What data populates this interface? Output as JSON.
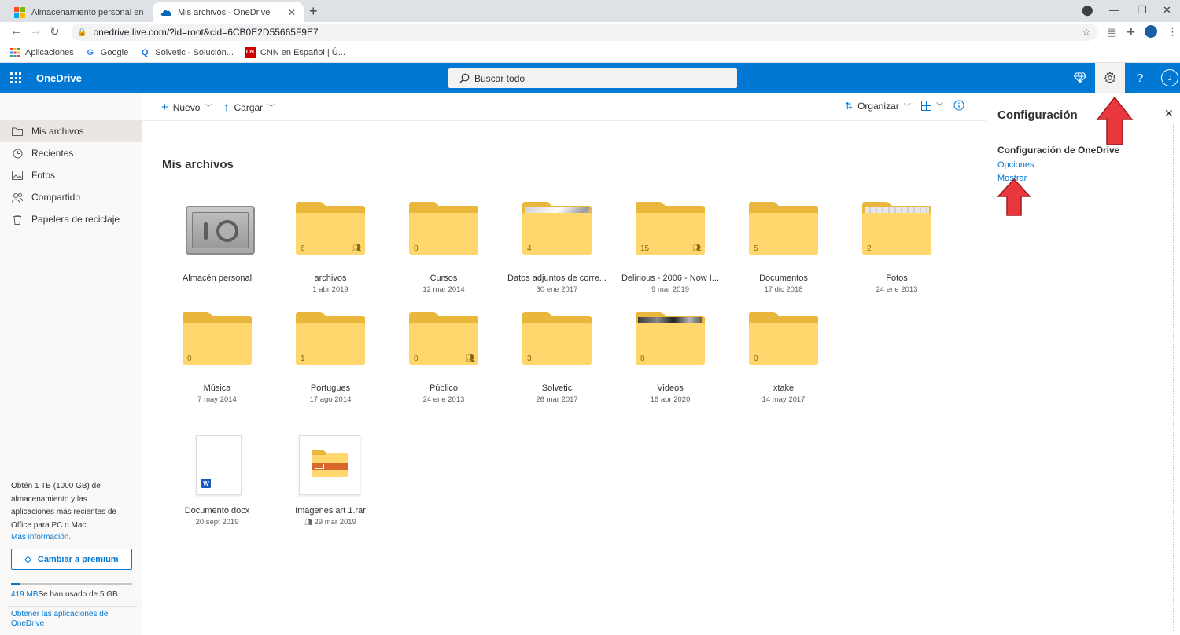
{
  "browser": {
    "tabs": [
      {
        "title": "Almacenamiento personal en la c",
        "active": false
      },
      {
        "title": "Mis archivos - OneDrive",
        "active": true
      }
    ],
    "url": "onedrive.live.com/?id=root&cid=6CB0E2D55665F9E7",
    "bookmarks": [
      {
        "label": "Aplicaciones",
        "icon": "apps-grid-icon"
      },
      {
        "label": "Google",
        "icon": "google-icon"
      },
      {
        "label": "Solvetic - Solución...",
        "icon": "solvetic-icon"
      },
      {
        "label": "CNN en Español | Ú...",
        "icon": "cnn-icon"
      }
    ]
  },
  "suitebar": {
    "app_name": "OneDrive",
    "search_placeholder": "Buscar todo",
    "avatar_initial": "J",
    "help_label": "?"
  },
  "nav": {
    "items": [
      {
        "label": "Mis archivos",
        "icon": "folder-icon",
        "active": true
      },
      {
        "label": "Recientes",
        "icon": "clock-icon",
        "active": false
      },
      {
        "label": "Fotos",
        "icon": "photo-icon",
        "active": false
      },
      {
        "label": "Compartido",
        "icon": "people-icon",
        "active": false
      },
      {
        "label": "Papelera de reciclaje",
        "icon": "trash-icon",
        "active": false
      }
    ],
    "promo_text": "Obtén 1 TB (1000 GB) de almacenamiento y las aplicaciones más recientes de Office para PC o Mac.",
    "promo_link": "Más información.",
    "premium_button": "Cambiar a premium",
    "quota_used": "419 MB",
    "quota_rest": "Se han usado de 5 GB",
    "quota_fraction": 0.08,
    "get_apps": "Obtener las aplicaciones de OneDrive"
  },
  "commandbar": {
    "new_label": "Nuevo",
    "upload_label": "Cargar",
    "sort_label": "Organizar"
  },
  "main": {
    "title": "Mis archivos",
    "items": [
      {
        "name": "Almacén personal",
        "date": "",
        "kind": "vault"
      },
      {
        "name": "archivos",
        "date": "1 abr 2019",
        "kind": "folder",
        "count": "6",
        "shared": true
      },
      {
        "name": "Cursos",
        "date": "12 mar 2014",
        "kind": "folder",
        "count": "0",
        "shared": false
      },
      {
        "name": "Datos adjuntos de corre...",
        "date": "30 ene 2017",
        "kind": "folder",
        "count": "4",
        "shared": false,
        "thumb": "photo"
      },
      {
        "name": "Delirious - 2006 - Now I...",
        "date": "9 mar 2019",
        "kind": "folder",
        "count": "15",
        "shared": true
      },
      {
        "name": "Documentos",
        "date": "17 dic 2018",
        "kind": "folder",
        "count": "5",
        "shared": false
      },
      {
        "name": "Fotos",
        "date": "24 ene 2013",
        "kind": "folder",
        "count": "2",
        "shared": false,
        "thumb": "paper"
      },
      {
        "name": "Música",
        "date": "7 may 2014",
        "kind": "folder",
        "count": "0",
        "shared": false
      },
      {
        "name": "Portugues",
        "date": "17 ago 2014",
        "kind": "folder",
        "count": "1",
        "shared": false
      },
      {
        "name": "Público",
        "date": "24 ene 2013",
        "kind": "folder",
        "count": "0",
        "shared": true
      },
      {
        "name": "Solvetic",
        "date": "26 mar 2017",
        "kind": "folder",
        "count": "3",
        "shared": false
      },
      {
        "name": "Videos",
        "date": "16 abr 2020",
        "kind": "folder",
        "count": "8",
        "shared": false,
        "thumb": "dark"
      },
      {
        "name": "xtake",
        "date": "14 may 2017",
        "kind": "folder",
        "count": "0",
        "shared": false
      },
      {
        "name": "Documento.docx",
        "date": "20 sept 2019",
        "kind": "word"
      },
      {
        "name": "Imagenes art 1.rar",
        "date": "29 mar 2019",
        "kind": "rar",
        "shared": true
      }
    ]
  },
  "settings": {
    "title": "Configuración",
    "section": "Configuración de OneDrive",
    "links": [
      "Opciones",
      "Mostrar"
    ]
  },
  "colors": {
    "accent": "#0078d4",
    "folder_front": "#ffd76c",
    "folder_back": "#e9b73c",
    "annotation_arrow": "#e8383d"
  }
}
